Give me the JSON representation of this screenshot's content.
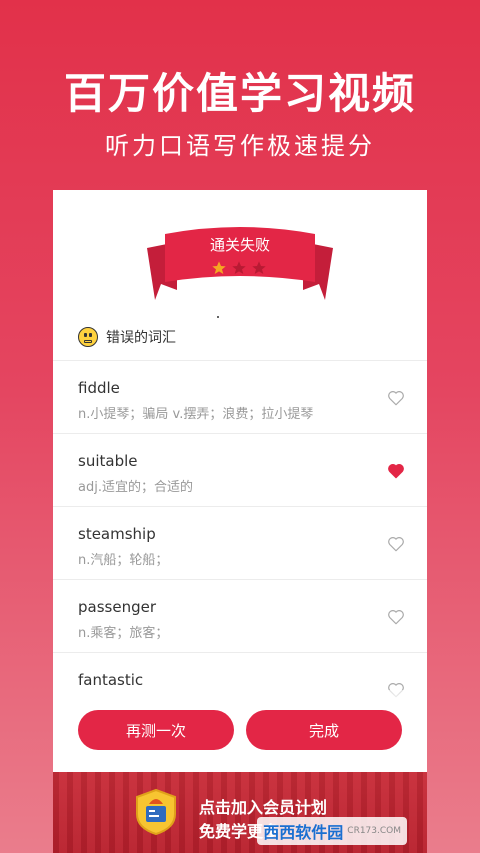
{
  "hero": {
    "title": "百万价值学习视频",
    "subtitle": "听力口语写作极速提分"
  },
  "result": {
    "label": "通关失败",
    "stars_earned": 1,
    "stars_total": 3
  },
  "wrong_words": {
    "header": "错误的词汇",
    "items": [
      {
        "word": "fiddle",
        "meaning": "n.小提琴；骗局 v.摆弄；浪费；拉小提琴",
        "favorited": false
      },
      {
        "word": "suitable",
        "meaning": "adj.适宜的；合适的",
        "favorited": true
      },
      {
        "word": "steamship",
        "meaning": "n.汽船；轮船；",
        "favorited": false
      },
      {
        "word": "passenger",
        "meaning": "n.乘客；旅客；",
        "favorited": false
      },
      {
        "word": "fantastic",
        "meaning": "",
        "favorited": false
      }
    ]
  },
  "actions": {
    "retry": "再测一次",
    "done": "完成"
  },
  "banner": {
    "line1": "点击加入会员计划",
    "line2": "免费学更多"
  },
  "watermark": {
    "title": "西西软件园",
    "url": "CR173.COM"
  },
  "colors": {
    "brand": "#e32646",
    "heart_active": "#e32646",
    "star_active": "#f5a623"
  }
}
